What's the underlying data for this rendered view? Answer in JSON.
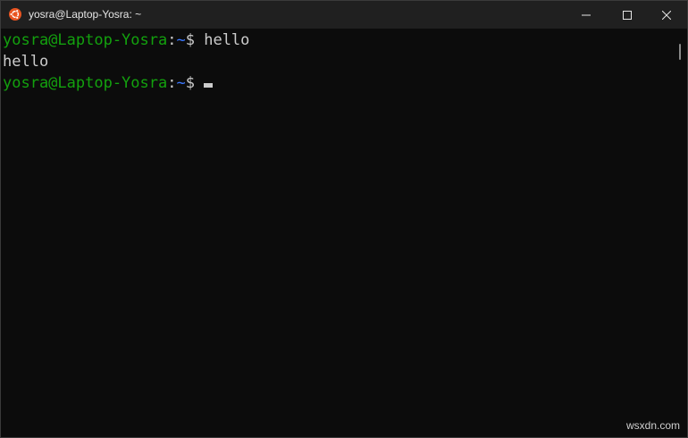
{
  "window": {
    "title": "yosra@Laptop-Yosra: ~",
    "icon": "ubuntu-logo-icon",
    "controls": {
      "minimize_icon": "minimize-icon",
      "maximize_icon": "maximize-icon",
      "close_icon": "close-icon"
    }
  },
  "terminal": {
    "lines": [
      {
        "user_host": "yosra@Laptop-Yosra",
        "separator": ":",
        "path": "~",
        "prompt": "$ ",
        "command": "hello"
      },
      {
        "output": "hello"
      },
      {
        "user_host": "yosra@Laptop-Yosra",
        "separator": ":",
        "path": "~",
        "prompt": "$ ",
        "command": ""
      }
    ]
  },
  "colors": {
    "background": "#0c0c0c",
    "titlebar": "#202020",
    "user_host": "#13a10e",
    "path": "#3b78ff",
    "text": "#cccccc",
    "ubuntu_orange": "#e95420"
  },
  "watermark": "wsxdn.com"
}
